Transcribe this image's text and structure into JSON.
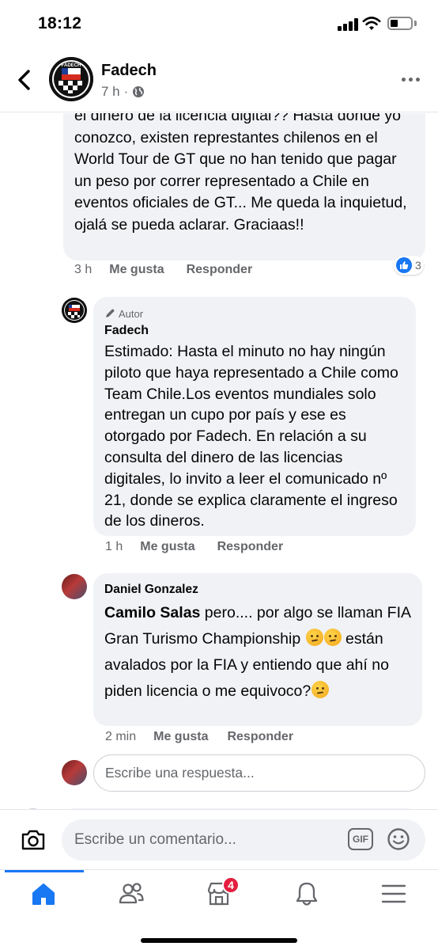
{
  "status_bar": {
    "time": "18:12"
  },
  "header": {
    "page_name": "Fadech",
    "post_age": "7 h",
    "separator": "·"
  },
  "comments": [
    {
      "text": "el dinero de la licencia digital?? Hasta donde yo conozco, existen represtantes chilenos en el World Tour de GT que no han tenido que pagar un peso por correr representado a Chile en eventos oficiales de GT... Me queda la inquietud, ojalá se pueda aclarar. Graciaas!!",
      "time": "3 h",
      "like_label": "Me gusta",
      "reply_label": "Responder",
      "reaction_count": "3"
    },
    {
      "author_badge": "Autor",
      "author": "Fadech",
      "text": "Estimado: Hasta el minuto no hay ningún piloto que haya representado a Chile como Team Chile.Los eventos mundiales solo entregan un cupo por país y ese es otorgado por Fadech. En relación a su consulta del dinero de las licencias digitales, lo invito a leer el comunicado nº 21, donde se explica claramente el ingreso de los dineros.",
      "time": "1 h",
      "like_label": "Me gusta",
      "reply_label": "Responder"
    },
    {
      "author": "Daniel Gonzalez",
      "mention": "Camilo Salas",
      "text_before_emoji": " pero.... por algo se llaman FIA Gran Turismo Championship ",
      "text_after_emoji": " están avalados por la FIA y entiendo que ahí no piden licencia o me equivoco?",
      "emoji_name": "thinking-face",
      "time": "2 min",
      "like_label": "Me gusta",
      "reply_label": "Responder"
    }
  ],
  "reply_input": {
    "placeholder": "Escribe una respuesta..."
  },
  "composer": {
    "placeholder": "Escribe un comentario...",
    "gif_label": "GIF"
  },
  "tabbar": {
    "tabs": [
      {
        "name": "home",
        "icon": "home-icon",
        "active": true
      },
      {
        "name": "friends",
        "icon": "friends-icon"
      },
      {
        "name": "marketplace",
        "icon": "marketplace-icon",
        "badge": "4"
      },
      {
        "name": "notifications",
        "icon": "bell-icon"
      },
      {
        "name": "menu",
        "icon": "menu-icon"
      }
    ]
  },
  "colors": {
    "accent": "#1877f2",
    "bubble": "#f0f2f5",
    "secondary_text": "#65676b",
    "badge": "#e41e3f"
  }
}
